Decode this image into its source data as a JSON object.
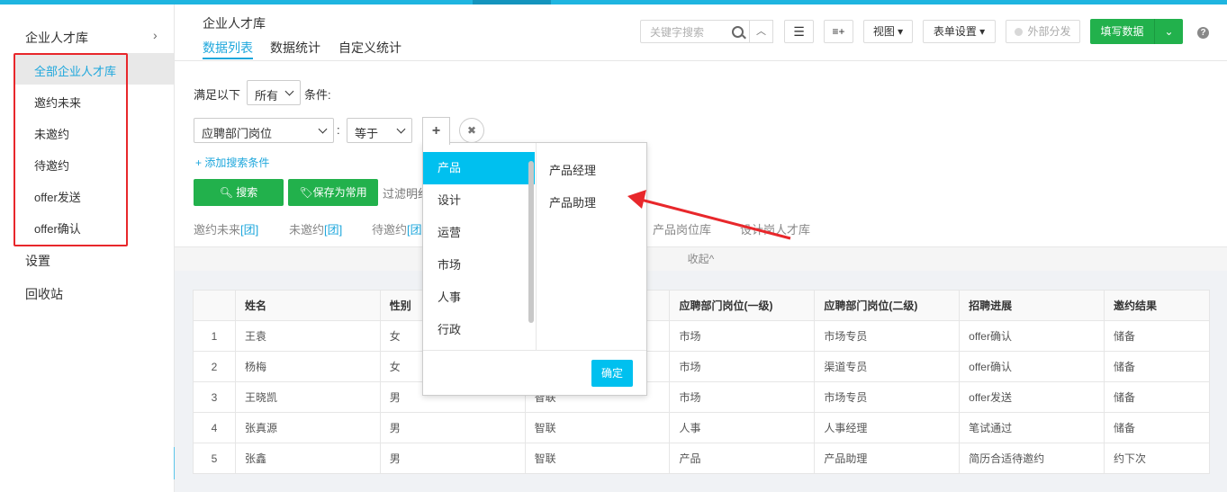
{
  "sidebar": {
    "header": "企业人才库",
    "items": [
      "全部企业人才库",
      "邀约未来",
      "未邀约",
      "待邀约",
      "offer发送",
      "offer确认"
    ],
    "settings": "设置",
    "recycle": "回收站"
  },
  "header": {
    "title": "企业人才库",
    "tabs": [
      "数据列表",
      "数据统计",
      "自定义统计"
    ]
  },
  "toolbar": {
    "search_placeholder": "关键字搜索",
    "view": "视图",
    "form_settings": "表单设置",
    "external": "外部分发",
    "fill_data": "填写数据"
  },
  "filter": {
    "prefix": "满足以下",
    "match_mode": "所有",
    "suffix": "条件:",
    "field": "应聘部门岗位",
    "operator": "等于",
    "add_condition": "+ 添加搜索条件",
    "search_button": "搜索",
    "save_button": "保存为常用",
    "hint": "过滤明细",
    "quick_filters": [
      {
        "name": "邀约未来",
        "tag": "[团]"
      },
      {
        "name": "未邀约",
        "tag": "[团]"
      },
      {
        "name": "待邀约",
        "tag": "[团"
      },
      {
        "name": "产品岗位库",
        "tag": ""
      },
      {
        "name": "设计岗人才库",
        "tag": ""
      }
    ],
    "collapse": "收起^"
  },
  "popup": {
    "level1": [
      "产品",
      "设计",
      "运营",
      "市场",
      "人事",
      "行政"
    ],
    "level2": [
      "产品经理",
      "产品助理"
    ],
    "confirm": "确定"
  },
  "table": {
    "columns": [
      "",
      "姓名",
      "性别",
      "",
      "应聘部门岗位(一级)",
      "应聘部门岗位(二级)",
      "招聘进展",
      "邀约结果"
    ],
    "rows": [
      [
        "1",
        "王袁",
        "女",
        "",
        "市场",
        "市场专员",
        "offer确认",
        "储备"
      ],
      [
        "2",
        "杨梅",
        "女",
        "",
        "市场",
        "渠道专员",
        "offer确认",
        "储备"
      ],
      [
        "3",
        "王晓凯",
        "男",
        "智联",
        "市场",
        "市场专员",
        "offer发送",
        "储备"
      ],
      [
        "4",
        "张真源",
        "男",
        "智联",
        "人事",
        "人事经理",
        "笔试通过",
        "储备"
      ],
      [
        "5",
        "张鑫",
        "男",
        "智联",
        "产品",
        "产品助理",
        "简历合适待邀约",
        "约下次"
      ]
    ]
  },
  "colors": {
    "accent": "#1ea7dc",
    "green": "#22b14c",
    "popup_active": "#00c0ef",
    "annotation_red": "#e8272b"
  }
}
